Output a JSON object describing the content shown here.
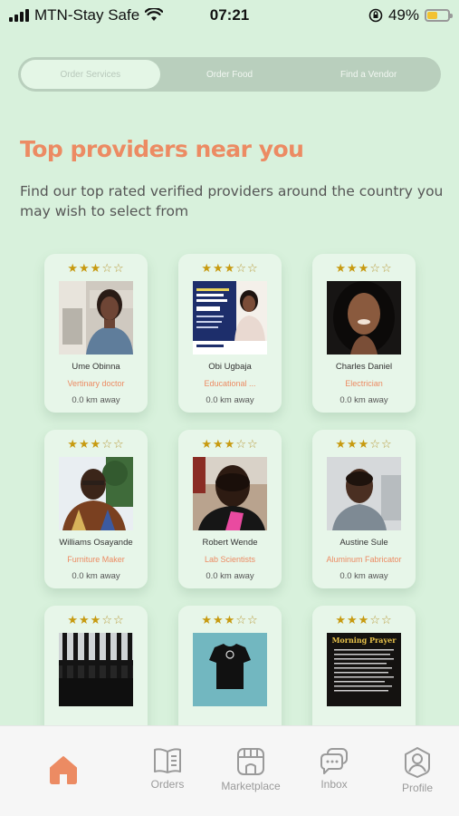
{
  "status_bar": {
    "carrier": "MTN-Stay Safe",
    "time": "07:21",
    "battery": "49%",
    "battery_level": 0.49
  },
  "tabs": [
    {
      "label": "Order Services",
      "active": true
    },
    {
      "label": "Order Food",
      "active": false
    },
    {
      "label": "Find a Vendor",
      "active": false
    }
  ],
  "main": {
    "title": "Top providers near you",
    "subtitle": "Find our top rated verified providers around the country you may wish to select from"
  },
  "providers": [
    {
      "name": "Ume Obinna",
      "role": "Vertinary doctor",
      "distance": "0.0 km away",
      "rating": 3,
      "max_rating": 5
    },
    {
      "name": "Obi Ugbaja",
      "role": "Educational ...",
      "distance": "0.0 km away",
      "rating": 3,
      "max_rating": 5
    },
    {
      "name": "Charles Daniel",
      "role": "Electrician",
      "distance": "0.0 km away",
      "rating": 3,
      "max_rating": 5
    },
    {
      "name": "Williams Osayande",
      "role": "Furniture Maker",
      "distance": "0.0 km away",
      "rating": 3,
      "max_rating": 5
    },
    {
      "name": "Robert Wende",
      "role": "Lab Scientists",
      "distance": "0.0 km away",
      "rating": 3,
      "max_rating": 5
    },
    {
      "name": "Austine Sule",
      "role": "Aluminum Fabricator",
      "distance": "0.0 km away",
      "rating": 3,
      "max_rating": 5
    },
    {
      "name": "",
      "role": "",
      "distance": "",
      "rating": 3,
      "max_rating": 5
    },
    {
      "name": "",
      "role": "",
      "distance": "",
      "rating": 3,
      "max_rating": 5
    },
    {
      "name": "",
      "role": "",
      "distance": "",
      "rating": 3,
      "max_rating": 5,
      "photo_text": "Morning Prayer"
    }
  ],
  "bottom_nav": [
    {
      "label": "",
      "icon": "home-icon",
      "active": true
    },
    {
      "label": "Orders",
      "icon": "orders-icon",
      "active": false
    },
    {
      "label": "Marketplace",
      "icon": "marketplace-icon",
      "active": false
    },
    {
      "label": "Inbox",
      "icon": "inbox-icon",
      "active": false
    },
    {
      "label": "Profile",
      "icon": "profile-icon",
      "active": false
    }
  ],
  "colors": {
    "background": "#d8f1dc",
    "accent": "#ec8b63",
    "star": "#c79a10",
    "card": "#e7f6e9"
  }
}
